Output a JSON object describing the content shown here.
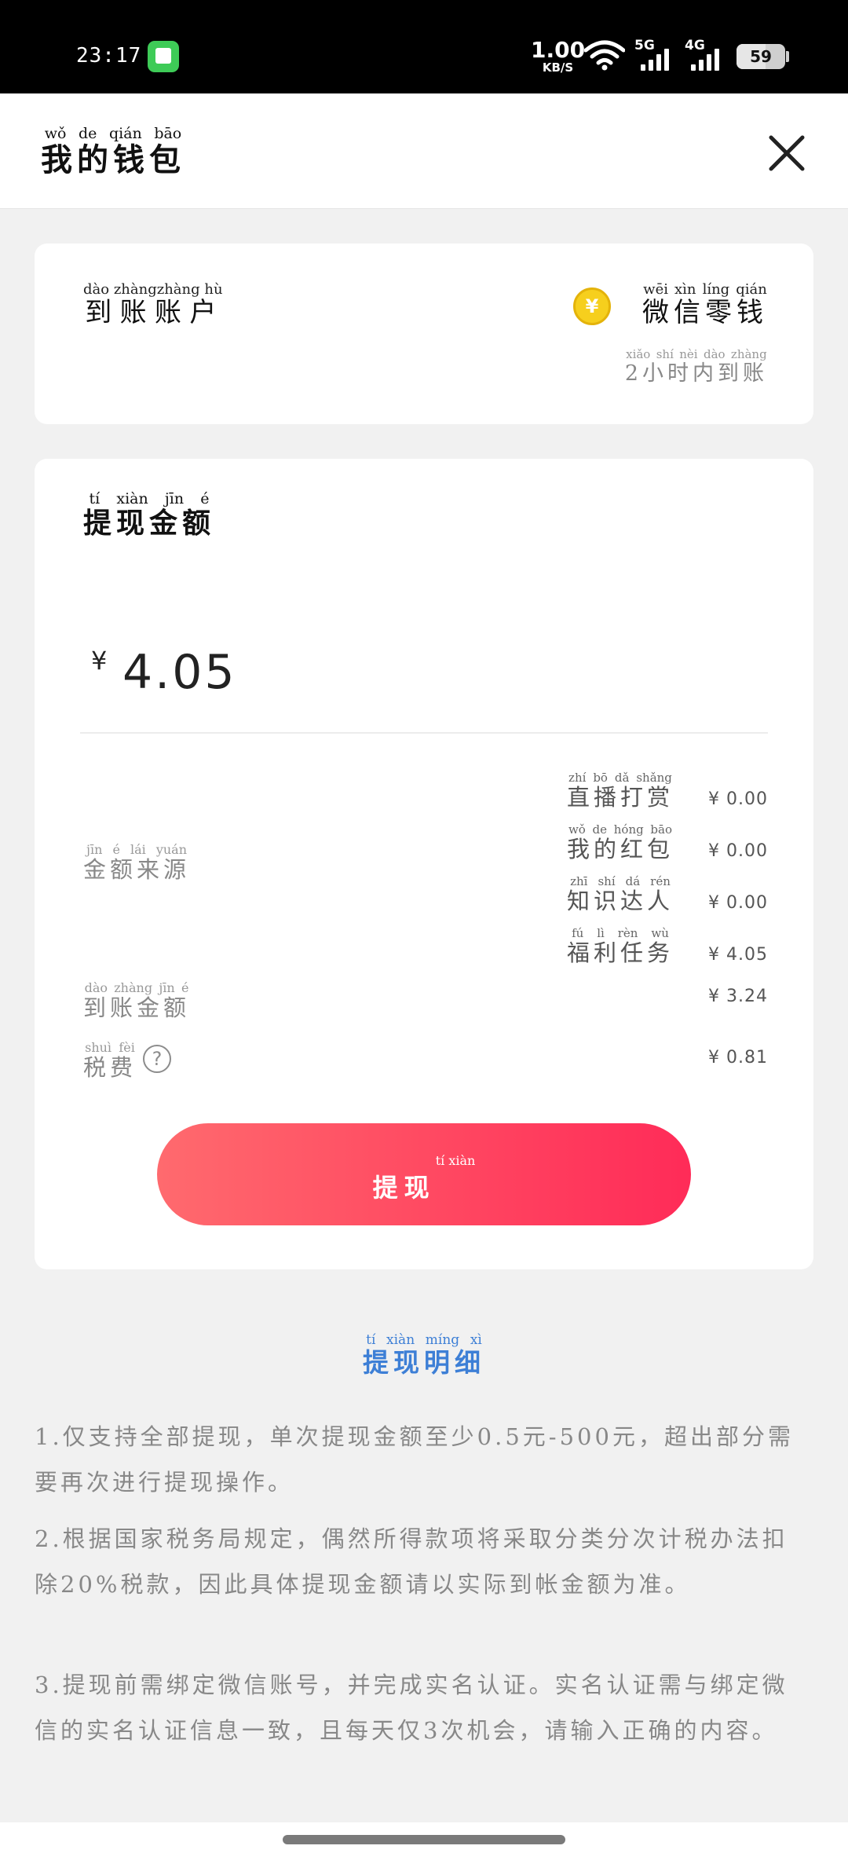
{
  "status_bar": {
    "time": "23:17",
    "net_speed_value": "1.00",
    "net_speed_unit": "KB/S",
    "signal_1_label": "5G",
    "signal_2_label": "4G",
    "battery": "59",
    "battery_level": 0.59
  },
  "header": {
    "title": "我的钱包",
    "title_pinyin": "wǒ de qián bāo",
    "close_icon": "close-icon"
  },
  "account": {
    "label": "到账账户",
    "label_pinyin": "dào zhàngzhàng hù",
    "method": "微信零钱",
    "method_pinyin": "wēi xìn líng qián",
    "note": "2小时内到账",
    "note_pinyin": "xiǎo shí nèi dào zhàng",
    "coin_symbol": "¥"
  },
  "amount": {
    "title": "提现金额",
    "title_pinyin": "tí xiàn jīn é",
    "currency": "¥",
    "value": "4.05",
    "source_label": "金额来源",
    "source_label_pinyin": "jīn é lái yuán",
    "sources": [
      {
        "name": "直播打赏",
        "pinyin": "zhí bō dǎ shǎng",
        "value": "¥ 0.00"
      },
      {
        "name": "我的红包",
        "pinyin": "wǒ de hóng bāo",
        "value": "¥ 0.00"
      },
      {
        "name": "知识达人",
        "pinyin": "zhī shí dá rén",
        "value": "¥ 0.00"
      },
      {
        "name": "福利任务",
        "pinyin": "fú lì rèn wù",
        "value": "¥ 4.05"
      }
    ],
    "arrive_label": "到账金额",
    "arrive_label_pinyin": "dào zhàng jīn é",
    "arrive_value": "¥ 3.24",
    "tax_label": "税费",
    "tax_label_pinyin": "shuì fèi",
    "tax_value": "¥ 0.81",
    "button_label": "提现",
    "button_pinyin": "tí xiàn"
  },
  "details": {
    "title": "提现明细",
    "title_pinyin": "tí xiàn míng xì",
    "rules": [
      "1.仅支持全部提现，单次提现金额至少0.5元-500元，超出部分需要再次进行提现操作。",
      "2.根据国家税务局规定，偶然所得款项将采取分类分次计税办法扣除20%税款，因此具体提现金额请以实际到帐金额为准。",
      "3.提现前需绑定微信账号，并完成实名认证。实名认证需与绑定微信的实名认证信息一致，且每天仅3次机会，请输入正确的内容。"
    ]
  },
  "colors": {
    "accent_blue": "#3d7fd6",
    "button_start": "#ff6a6e",
    "button_end": "#ff2b58",
    "coin": "#f6cf1d"
  }
}
